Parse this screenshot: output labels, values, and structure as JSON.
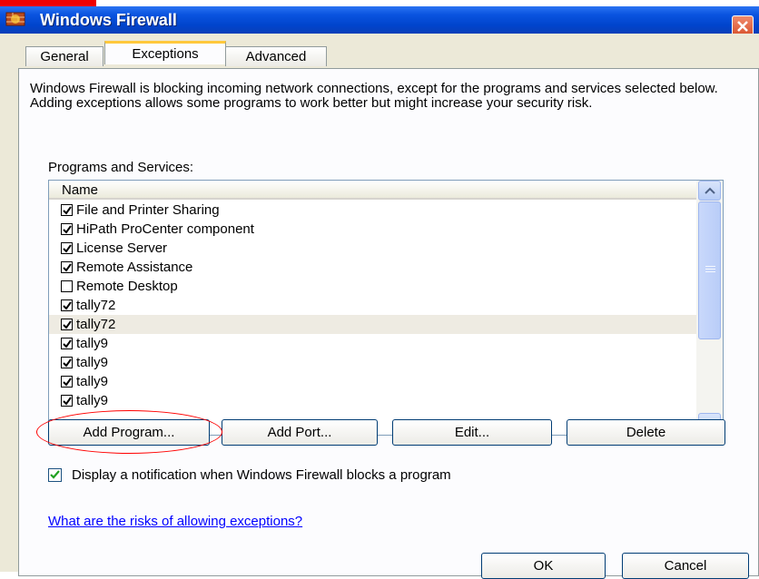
{
  "window": {
    "title": "Windows Firewall"
  },
  "tabs": [
    {
      "label": "General",
      "active": false
    },
    {
      "label": "Exceptions",
      "active": true
    },
    {
      "label": "Advanced",
      "active": false
    }
  ],
  "description": "Windows Firewall is blocking incoming network connections, except for the programs and services selected below. Adding exceptions allows some programs to work better but might increase your security risk.",
  "programs_label": "Programs and Services:",
  "list": {
    "header": "Name",
    "items": [
      {
        "label": "File and Printer Sharing",
        "checked": true
      },
      {
        "label": "HiPath ProCenter component",
        "checked": true
      },
      {
        "label": "License Server",
        "checked": true
      },
      {
        "label": "Remote Assistance",
        "checked": true
      },
      {
        "label": "Remote Desktop",
        "checked": false
      },
      {
        "label": "tally72",
        "checked": true
      },
      {
        "label": "tally72",
        "checked": true,
        "selected": true
      },
      {
        "label": "tally9",
        "checked": true
      },
      {
        "label": "tally9",
        "checked": true
      },
      {
        "label": "tally9",
        "checked": true
      },
      {
        "label": "tally9",
        "checked": true
      }
    ]
  },
  "buttons": {
    "add_program": "Add Program...",
    "add_port": "Add Port...",
    "edit": "Edit...",
    "delete": "Delete",
    "ok": "OK",
    "cancel": "Cancel"
  },
  "notification": {
    "label": "Display a notification when Windows Firewall blocks a program",
    "checked": true
  },
  "link": "What are the risks of allowing exceptions?",
  "colors": {
    "titlebar": "#0054e3",
    "annotation": "#ff0000",
    "link": "#0000ff",
    "dialog_bg": "#ece9d8"
  }
}
